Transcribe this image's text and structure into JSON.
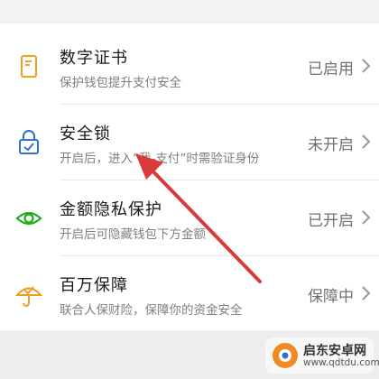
{
  "settings": {
    "items": [
      {
        "title": "数字证书",
        "subtitle": "保护钱包提升支付安全",
        "status": "已启用",
        "icon": "certificate-icon",
        "icon_color": "#f0a020"
      },
      {
        "title": "安全锁",
        "subtitle": "开启后，进入“我-支付”时需验证身份",
        "status": "未开启",
        "icon": "lock-icon",
        "icon_color": "#2f6fd6"
      },
      {
        "title": "金额隐私保护",
        "subtitle": "开启后可隐藏钱包下方金额",
        "status": "已开启",
        "icon": "eye-icon",
        "icon_color": "#1aad19"
      },
      {
        "title": "百万保障",
        "subtitle": "联合人保财险，保障你的资金安全",
        "status": "保障中",
        "icon": "umbrella-icon",
        "icon_color": "#f0a020"
      }
    ]
  },
  "annotation": {
    "color": "#d93a3a"
  },
  "watermark": {
    "name": "启东安卓网",
    "url": "www.qdtdu.com"
  }
}
